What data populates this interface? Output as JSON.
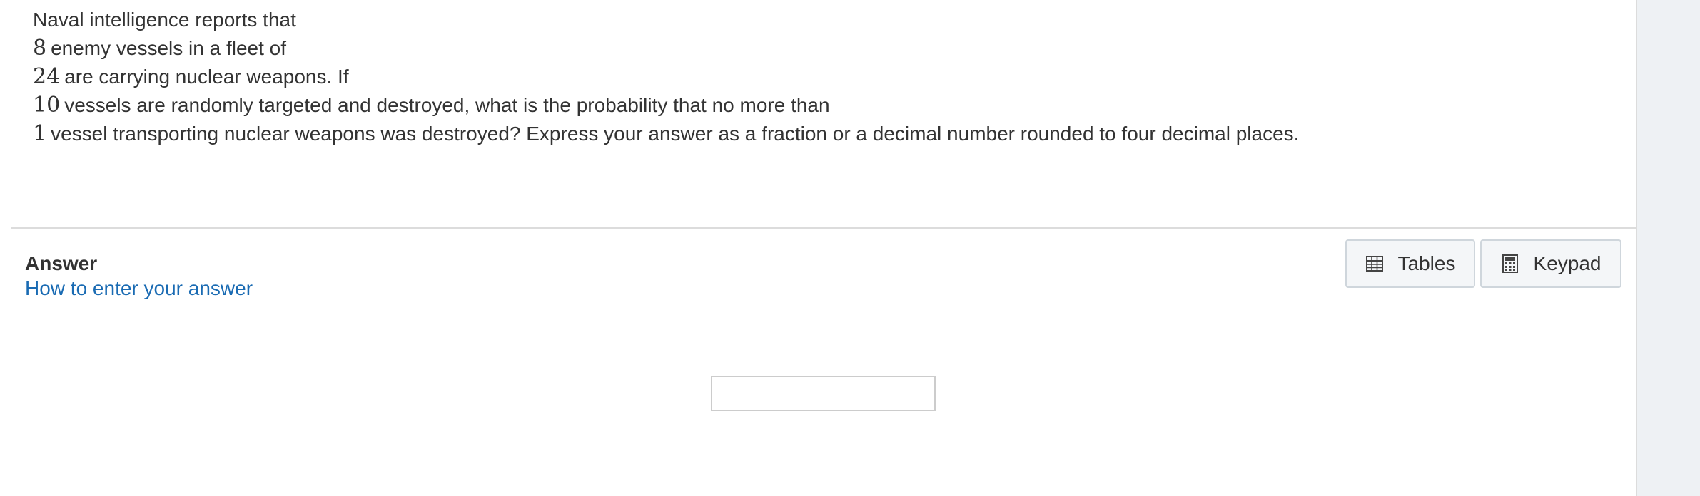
{
  "question": {
    "lines": [
      {
        "num": "",
        "text": "Naval intelligence reports that"
      },
      {
        "num": "8",
        "text": "enemy vessels in a fleet of"
      },
      {
        "num": "24",
        "text": "are carrying nuclear weapons. If"
      },
      {
        "num": "10",
        "text": "vessels are randomly targeted and destroyed, what is the probability that no more than"
      },
      {
        "num": "1",
        "text": "vessel transporting nuclear weapons was destroyed? Express your answer as a fraction or a decimal number rounded to four decimal places."
      }
    ]
  },
  "answer": {
    "heading": "Answer",
    "help_link": "How to enter your answer",
    "input_value": "",
    "input_placeholder": ""
  },
  "tools": {
    "tables_label": "Tables",
    "tables_icon": "table-icon",
    "keypad_label": "Keypad",
    "keypad_icon": "calculator-icon"
  },
  "colors": {
    "text": "#333333",
    "link": "#1a6bb3",
    "border": "#dcdcdc",
    "button_bg": "#f4f6f8",
    "gutter": "#eef1f4"
  }
}
